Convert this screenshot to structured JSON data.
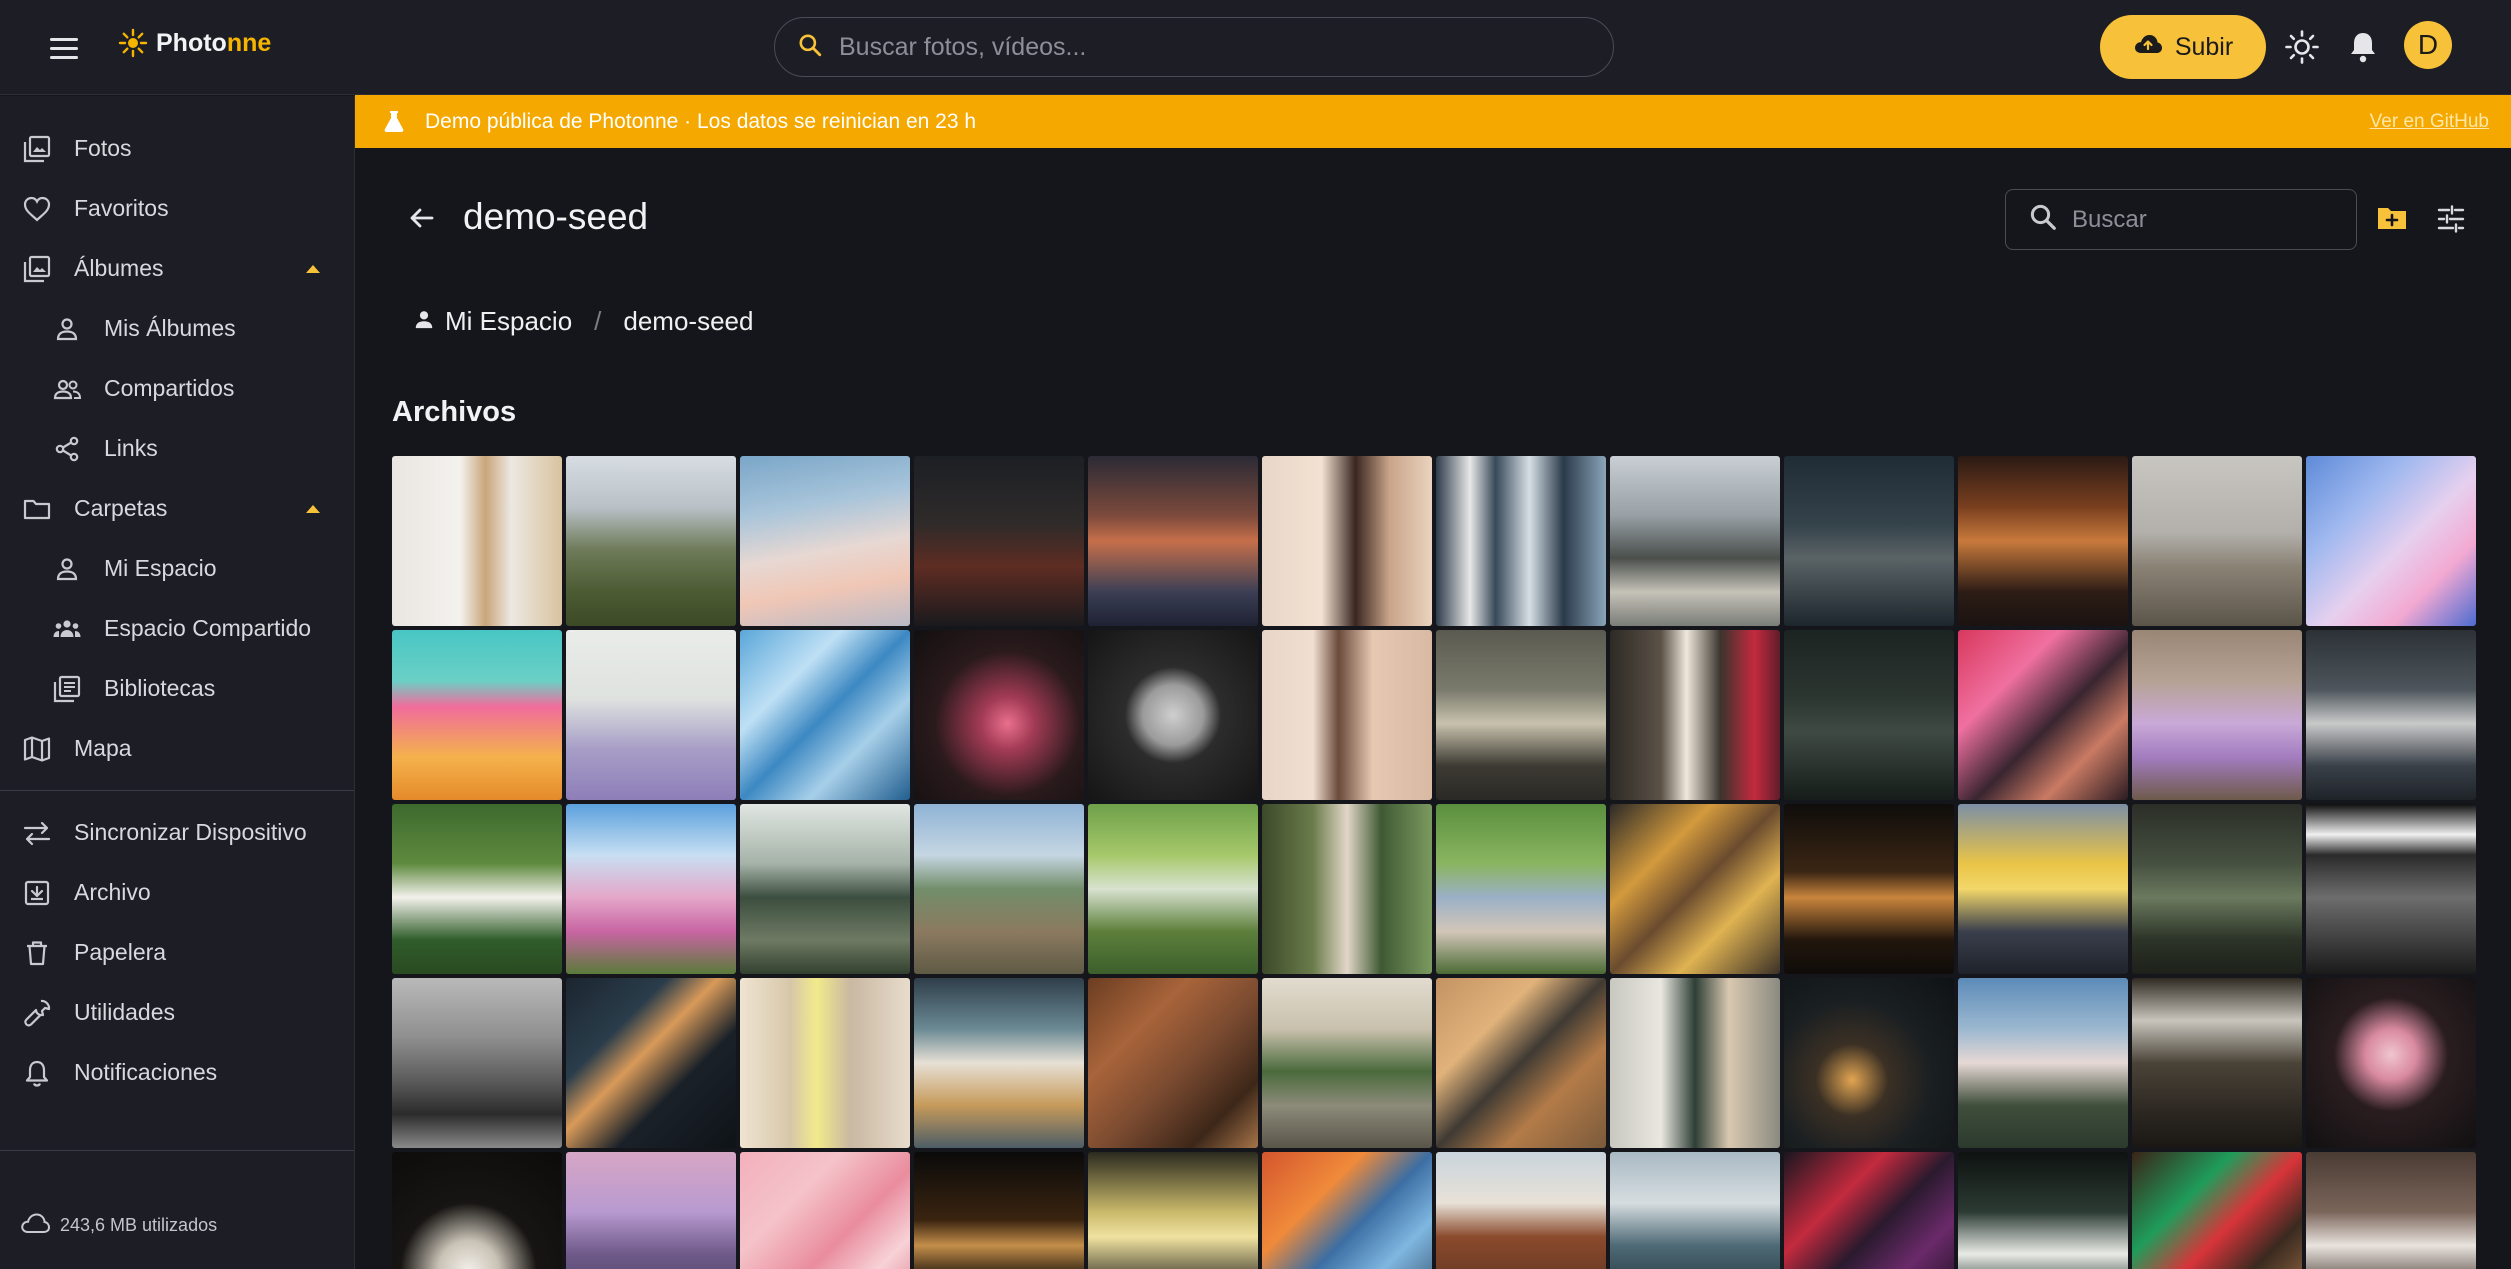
{
  "topbar": {
    "logo_part1": "Photo",
    "logo_part2": "nne",
    "search_placeholder": "Buscar fotos, vídeos...",
    "upload_label": "Subir",
    "avatar_initial": "D"
  },
  "banner": {
    "text": "Demo pública de Photonne · Los datos se reinician en 23 h",
    "link": "Ver en GitHub"
  },
  "sidebar": {
    "items": [
      {
        "label": "Fotos"
      },
      {
        "label": "Favoritos"
      },
      {
        "label": "Álbumes"
      },
      {
        "label": "Mis Álbumes"
      },
      {
        "label": "Compartidos"
      },
      {
        "label": "Links"
      },
      {
        "label": "Carpetas"
      },
      {
        "label": "Mi Espacio"
      },
      {
        "label": "Espacio Compartido"
      },
      {
        "label": "Bibliotecas"
      },
      {
        "label": "Mapa"
      },
      {
        "label": "Sincronizar Dispositivo"
      },
      {
        "label": "Archivo"
      },
      {
        "label": "Papelera"
      },
      {
        "label": "Utilidades"
      },
      {
        "label": "Notificaciones"
      }
    ],
    "storage": "243,6 MB utilizados"
  },
  "main": {
    "title": "demo-seed",
    "search_placeholder": "Buscar",
    "breadcrumb": [
      "Mi Espacio",
      "demo-seed"
    ],
    "section_title": "Archivos"
  },
  "colors": {
    "accent": "#f7c13a",
    "banner": "#f5a800",
    "background": "#15161c",
    "surface": "#1d1e25"
  },
  "thumbnails": [
    "linear-gradient(90deg,#e9e6e1 0%,#f4f2ee 40%,#c9a57a 55%,#ece8e2 70%,#d9c39f 100%)",
    "linear-gradient(180deg,#d7dde2 0%,#b9c1c7 30%,#6f7b5a 55%,#4b5b32 80%,#3c4a26 100%)",
    "linear-gradient(170deg,#7aa6c8 0%,#a7c4da 30%,#e7d8d3 55%,#f0c7b6 75%,#b9b9c5 100%)",
    "linear-gradient(180deg,#1c1f24 0%,#2f2b2a 40%,#5e2c22 65%,#1a1a1d 100%)",
    "linear-gradient(180deg,#2b2a35 0%,#7c4a3c 35%,#c66f4a 50%,#3c3f55 80%,#1e2233 100%)",
    "linear-gradient(90deg,#e8d7c8 0%,#f3e2d2 35%,#3a2620 55%,#c9a48a 75%,#ead3bd 100%)",
    "linear-gradient(90deg,#2d3c4a 0%,#e8e8e8 20%,#38495a 35%,#d6dfe5 55%,#2a3a4a 75%,#8aa4b8 100%)",
    "linear-gradient(180deg,#c9cfd4 0%,#98a0a5 35%,#4a4f4c 60%,#c5c2b8 80%,#7a7d78 100%)",
    "linear-gradient(180deg,#1f2b35 0%,#34424a 40%,#5a6366 60%,#1d262c 100%)",
    "linear-gradient(180deg,#2a1a14 0%,#7a3f1f 30%,#c87a3c 50%,#2c1c15 80%,#1b1311 100%)",
    "linear-gradient(180deg,#c8c6c1 0%,#b3b0ab 45%,#8a8275 65%,#5b5549 100%)",
    "linear-gradient(135deg,#5e8ad8 0%,#9fb8ef 30%,#e6d0ef 55%,#f3a9d2 75%,#4c6bd1 100%)",
    "linear-gradient(180deg,#48c6c3 0%,#6bd0c6 30%,#f06c9b 45%,#f4b24c 75%,#e58a2a 100%)",
    "linear-gradient(180deg,#e9ece9 0%,#dfe3df 40%,#a79ec7 70%,#8e7eb8 100%)",
    "linear-gradient(135deg,#5aa7d9 0%,#bfe0f5 30%,#3c88c2 50%,#a7cfe9 70%,#215e8f 100%)",
    "radial-gradient(circle at 55% 55%,#e9708d 0%,#a33b55 20%,#2a1a1c 55%,#120f10 100%)",
    "radial-gradient(circle at 50% 50%,#cfcfcf 0%,#9b9b9b 25%,#2c2c2c 40%,#151515 100%)",
    "linear-gradient(90deg,#e8d5c7 0%,#f0dfd1 30%,#6b4a3a 45%,#e5c9b3 65%,#d9b9a2 100%)",
    "linear-gradient(180deg,#5a5a50 0%,#7a7a6c 35%,#c8c2ad 55%,#3c3a33 80%,#2a2925 100%)",
    "linear-gradient(90deg,#2e2a25 0%,#5b5147 30%,#efe8dc 45%,#3b342e 65%,#c42a3e 85%,#5f1d2a 100%)",
    "linear-gradient(180deg,#1c2421 0%,#2c3631 40%,#3f4a44 60%,#151c19 100%)",
    "linear-gradient(135deg,#d8385c 0%,#f070a0 30%,#3a2530 55%,#c97a63 75%,#2b1b22 100%)",
    "linear-gradient(180deg,#9a8675 0%,#b6a294 30%,#c9a9d8 55%,#a27cbf 75%,#6e5a4a 100%)",
    "linear-gradient(180deg,#2c3136 0%,#4d565c 35%,#c9c9c9 55%,#394048 80%,#1e2328 100%)",
    "linear-gradient(180deg,#3d6a2e 0%,#5e8a3e 35%,#f3f1ec 55%,#2f5d2a 80%,#2a4a22 100%)",
    "linear-gradient(180deg,#5ba0dd 0%,#c7dff2 30%,#e4a7c9 55%,#c865a3 75%,#5b7a3a 100%)",
    "linear-gradient(180deg,#e1e6e2 0%,#a5b3a8 35%,#3c4e3f 55%,#6e7a63 80%,#32402f 100%)",
    "linear-gradient(180deg,#8fb3d6 0%,#c5d6e2 30%,#728e6a 50%,#8b7a60 75%,#5f5a45 100%)",
    "linear-gradient(180deg,#6ea04a 0%,#a6c86a 30%,#d8e2d0 50%,#5d7f3b 75%,#3c5f2c 100%)",
    "linear-gradient(90deg,#3c4a2a 0%,#6a7c4b 30%,#e2d6c8 50%,#3f5a34 70%,#7b9a5f 100%)",
    "linear-gradient(180deg,#5a8f3e 0%,#8ab560 35%,#9bb0c7 55%,#d2c6b8 75%,#4b6a34 100%)",
    "linear-gradient(135deg,#2c2a28 0%,#d39a3d 30%,#6a4b2e 50%,#e0b352 70%,#3b3127 100%)",
    "linear-gradient(180deg,#0f0d0b 0%,#3b2614 40%,#c9853c 55%,#22160d 80%,#0f0c09 100%)",
    "linear-gradient(180deg,#7c8fa5 0%,#e9c447 35%,#f3d76a 50%,#3a3f4c 75%,#1e222a 100%)",
    "linear-gradient(180deg,#2a2e27 0%,#465040 35%,#6b7a5f 55%,#2c3327 80%,#1c211a 100%)",
    "linear-gradient(180deg,#0f0f0f 0%,#f0f0f0 18%,#2a2a2a 30%,#6d6d6d 55%,#1a1a1a 100%)",
    "linear-gradient(180deg,#b9b9b9 0%,#8f8f8f 35%,#5c5c5c 60%,#2b2b2b 80%,#8a8a8a 100%)",
    "linear-gradient(135deg,#1b2530 0%,#2a3d4a 30%,#d89a59 45%,#1a2129 65%,#0e1317 100%)",
    "linear-gradient(90deg,#efe4d2 0%,#d7c7a9 30%,#f2ea8a 45%,#c9b8a2 65%,#e8dccb 100%)",
    "linear-gradient(180deg,#2e3e4a 0%,#6b8a94 30%,#e7e0d5 50%,#c69a5a 75%,#4d5d66 100%)",
    "linear-gradient(135deg,#6b3d22 0%,#a8643a 30%,#7a4a30 55%,#3d2719 80%,#a67449 100%)",
    "linear-gradient(180deg,#e1dccf 0%,#c9c1ad 30%,#4a6a3c 55%,#8d8b7a 75%,#5a5549 100%)",
    "linear-gradient(135deg,#c39463 0%,#e1b27a 30%,#3f3a33 50%,#b37b48 70%,#7a5a3b 100%)",
    "linear-gradient(90deg,#c8c8c0 0%,#e9e7e0 30%,#2e3f36 50%,#d9c8b0 70%,#8a8a80 100%)",
    "radial-gradient(circle at 40% 60%,#e2a552 0%,#3b3024 25%,#1a1f22 55%,#0e1214 100%)",
    "linear-gradient(180deg,#5c8bb8 0%,#9cb8d0 30%,#e6d8d4 50%,#3f4e3b 75%,#2b3a2d 100%)",
    "linear-gradient(180deg,#2f2a22 0%,#c9c5bc 25%,#4a4338 50%,#2b2620 80%,#1a1714 100%)",
    "radial-gradient(circle at 50% 45%,#f0c5cf 0%,#d98aa0 20%,#2a1d20 45%,#111011 100%)",
    "radial-gradient(circle at 45% 70%,#f3f0ea 0%,#c9c2b6 20%,#171513 45%,#0c0b0a 100%)",
    "linear-gradient(180deg,#d7a6c5 0%,#b89ad0 35%,#6f5a8a 60%,#3d3a4f 100%)",
    "linear-gradient(135deg,#f3b0bd 0%,#f5c3c9 30%,#e98c9e 55%,#f7d2d6 75%,#d9738a 100%)",
    "linear-gradient(180deg,#0a0a0a 0%,#3a2410 40%,#c48e4a 55%,#1b120a 75%,#080808 100%)",
    "linear-gradient(180deg,#2b2a1f 0%,#c8b86a 35%,#f0e2a0 50%,#4e4a38 75%,#2a2822 100%)",
    "linear-gradient(135deg,#d4562e 0%,#f08a3a 30%,#3c6ea3 50%,#7fb7e0 70%,#2a3f5b 100%)",
    "linear-gradient(180deg,#c9d4dc 0%,#e8e2d8 30%,#8a4a2c 50%,#6b3a25 75%,#b37855 100%)",
    "linear-gradient(180deg,#a9b9c3 0%,#d6dde0 30%,#4e6a76 55%,#2a3e46 80%,#1b2a30 100%)",
    "linear-gradient(135deg,#1a1620 0%,#c42a3e 30%,#2a1a2e 50%,#6a2a6a 70%,#0f0c12 100%)",
    "linear-gradient(180deg,#0e1210 0%,#2b3a33 35%,#e9ebe6 60%,#3c4a43 80%,#111512 100%)",
    "linear-gradient(135deg,#3a2418 0%,#1f9c5a 30%,#d8343a 50%,#3a2a20 70%,#b07a4a 100%)",
    "linear-gradient(180deg,#4a3b33 0%,#7a655a 35%,#e9e3de 55%,#4d4038 80%,#2e2622 100%)"
  ]
}
